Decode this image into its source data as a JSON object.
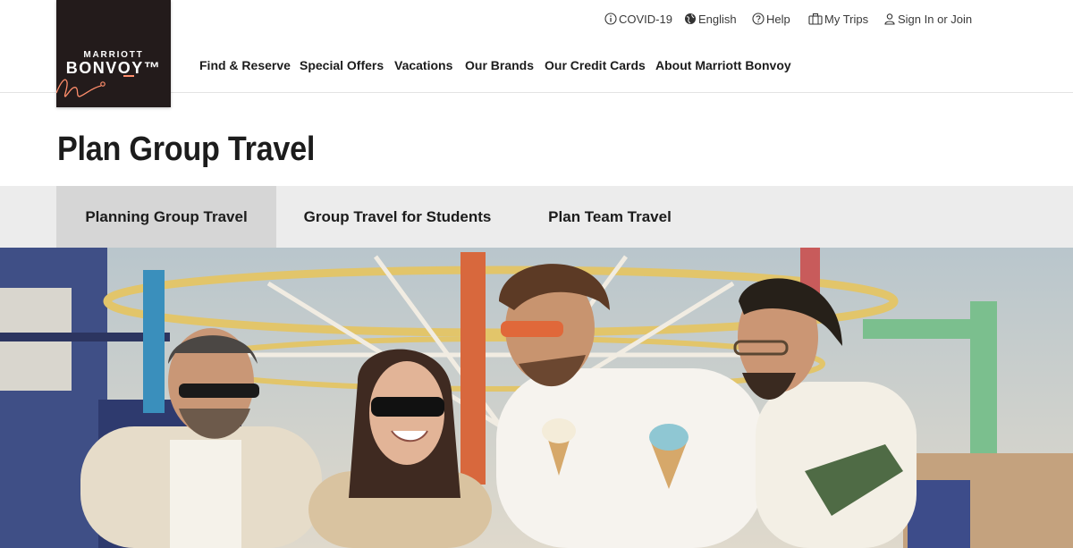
{
  "logo": {
    "line1": "MARRIOTT",
    "line2": "BONVOY™"
  },
  "utility_nav": [
    {
      "label": "COVID-19",
      "icon": "info-icon"
    },
    {
      "label": "English",
      "icon": "globe-icon"
    },
    {
      "label": "Help",
      "icon": "help-icon"
    },
    {
      "label": "My Trips",
      "icon": "suitcase-icon"
    },
    {
      "label": "Sign In or Join",
      "icon": "user-icon"
    }
  ],
  "main_nav": [
    {
      "label": "Find & Reserve"
    },
    {
      "label": "Special Offers"
    },
    {
      "label": "Vacations"
    },
    {
      "label": "Our Brands"
    },
    {
      "label": "Our Credit Cards"
    },
    {
      "label": "About Marriott Bonvoy"
    }
  ],
  "page": {
    "title": "Plan Group Travel"
  },
  "tabs": [
    {
      "label": "Planning Group Travel",
      "active": true
    },
    {
      "label": "Group Travel for Students",
      "active": false
    },
    {
      "label": "Plan Team Travel",
      "active": false
    }
  ],
  "colors": {
    "logo_bg": "#231b1b",
    "logo_accent": "#ff8d6b",
    "tab_bar": "#ececec",
    "tab_active": "#d6d6d6"
  }
}
